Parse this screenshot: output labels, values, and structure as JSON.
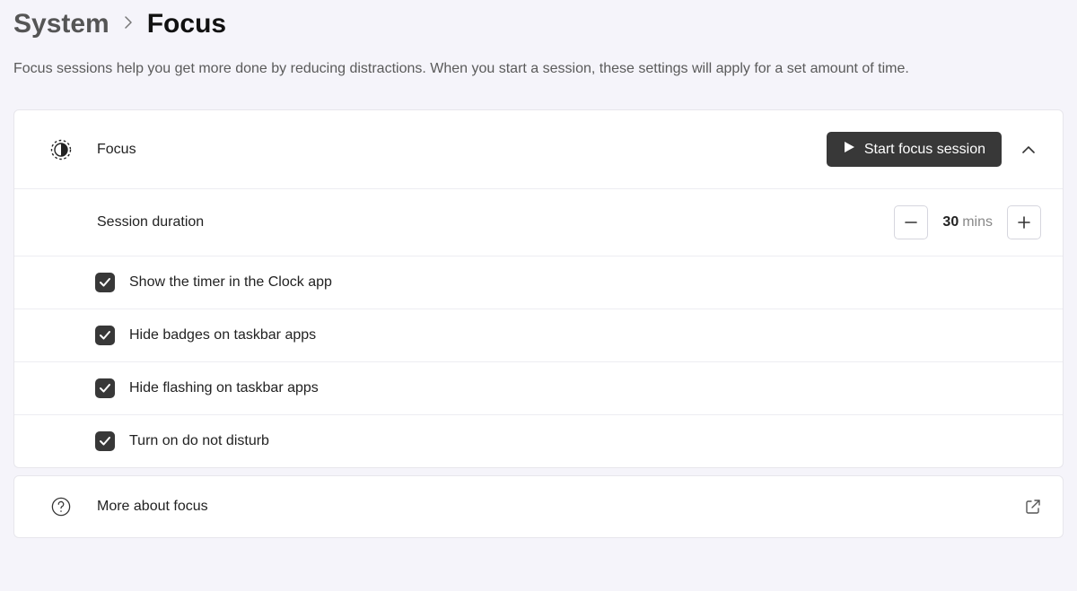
{
  "breadcrumb": {
    "parent": "System",
    "current": "Focus"
  },
  "description": "Focus sessions help you get more done by reducing distractions. When you start a session, these settings will apply for a set amount of time.",
  "focus": {
    "title": "Focus",
    "start_button": "Start focus session",
    "duration_label": "Session duration",
    "duration_value": "30",
    "duration_unit": "mins",
    "options": [
      "Show the timer in the Clock app",
      "Hide badges on taskbar apps",
      "Hide flashing on taskbar apps",
      "Turn on do not disturb"
    ]
  },
  "more": {
    "label": "More about focus"
  }
}
